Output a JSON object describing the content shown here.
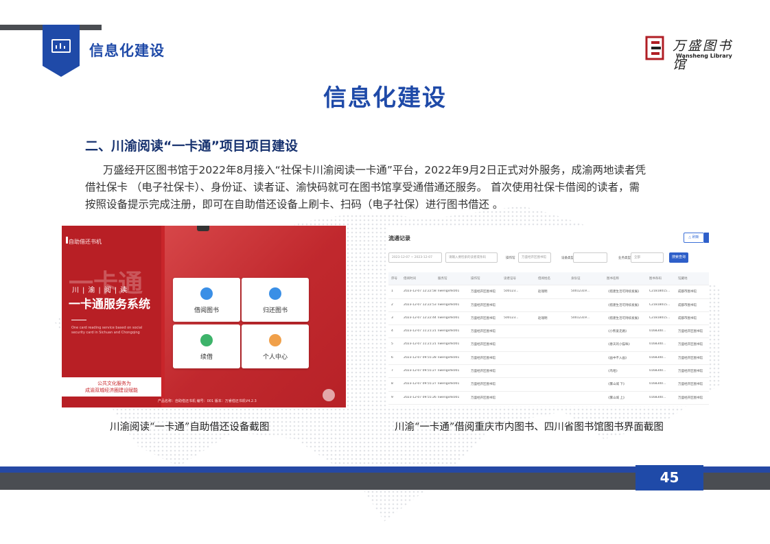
{
  "header": {
    "title": "信息化建设",
    "logo_cn": "万盛图书馆",
    "logo_en": "Wansheng Library"
  },
  "main_title": "信息化建设",
  "section_heading": "二、川渝阅读“一卡通”项目项目建设",
  "paragraph": {
    "line1": "万盛经开区图书馆于2022年8月接入“社保卡川渝阅读一卡通”平台，2022年9月2日正式对外服务，成渝两地读者凭",
    "line2": "借社保卡 （电子社保卡）、身份证、读者证、渝快码就可在图书馆享受通借通还服务。 首次使用社保卡借阅的读者，需",
    "line3": "按照设备提示完成注册，即可在自助借还设备上刷卡、扫码（电子社保）进行图书借还 。"
  },
  "left_screenshot": {
    "brand": "自助借还书机",
    "watermark": "一卡通",
    "subtitle": "川|渝|阅|读",
    "system_title": "一卡通服务系统",
    "english": "One card reading service based on social security card in Sichuan and Chongqing",
    "slogan1": "公共文化服务为",
    "slogan2": "成渝双城经济圈建设赋能",
    "footer": "产品名称：自助借还书机   编号：001   版本：万睿借还书机V4.2.3",
    "tiles": [
      {
        "label": "借阅图书"
      },
      {
        "label": "归还图书"
      },
      {
        "label": "续借"
      },
      {
        "label": "个人中心"
      }
    ]
  },
  "right_screenshot": {
    "title": "流通记录",
    "refresh_label": "△ 刷新",
    "date_range": "2023-12-07  ~  2023-12-07",
    "search_placeholder": "请输入要检索的读者或条码",
    "filter1_label": "操作馆",
    "filter1_value": "万盛经开区图书馆",
    "filter2_label": "设备类型",
    "filter3_label": "业务类型",
    "filter3_value": "全部",
    "search_button": "搜索查询",
    "columns": [
      "序号",
      "借阅时间",
      "服务馆",
      "操作馆",
      "读者证号",
      "借阅姓名",
      "身份证",
      "图书名称",
      "图书条码",
      "馆藏地"
    ],
    "rows": [
      [
        "1",
        "2023-12-07 12:22:58",
        "liwengxhk001",
        "万盛经开区图书馆",
        "500123...",
        "赵瑞明",
        "50012319...",
        "《搭建生活可持续发展》",
        "C21818015...",
        "成都市图书馆"
      ],
      [
        "2",
        "2023-12-07 12:22:53",
        "liwengxhk001",
        "万盛经开区图书馆",
        "",
        "",
        "",
        "《搭建生活可持续发展》",
        "C21818015...",
        "成都市图书馆"
      ],
      [
        "3",
        "2023-12-07 12:22:44",
        "liwengxhk001",
        "万盛经开区图书馆",
        "500123...",
        "赵瑞明",
        "50012319...",
        "《搭建生活可持续发展》",
        "C21818015...",
        "成都市图书馆"
      ],
      [
        "4",
        "2023-12-07 11:21:21",
        "liwengxhk001",
        "万盛经开区图书馆",
        "",
        "",
        "",
        "《小熊爱走路》",
        "0168300...",
        "万盛经开区图书馆"
      ],
      [
        "5",
        "2023-12-07 11:21:21",
        "liwengxhk001",
        "万盛经开区图书馆",
        "",
        "",
        "",
        "《春天的小猫咪》",
        "0168300...",
        "万盛经开区图书馆"
      ],
      [
        "6",
        "2023-12-07 09:55:28",
        "liwengxhk001",
        "万盛经开区图书馆",
        "",
        "",
        "",
        "《画中不入画》",
        "0168300...",
        "万盛经开区图书馆"
      ],
      [
        "7",
        "2023-12-07 09:55:27",
        "liwengxhk001",
        "万盛经开区图书馆",
        "",
        "",
        "",
        "《鸟哈》",
        "0168300...",
        "万盛经开区图书馆"
      ],
      [
        "8",
        "2023-12-07 09:55:27",
        "liwengxhk001",
        "万盛经开区图书馆",
        "",
        "",
        "",
        "《雾山城 下》",
        "0168300...",
        "万盛经开区图书馆"
      ],
      [
        "9",
        "2023-12-07 09:55:26",
        "liwengxhk001",
        "万盛经开区图书馆",
        "",
        "",
        "",
        "《雾山城 上》",
        "0168300...",
        "万盛经开区图书馆"
      ]
    ]
  },
  "captions": {
    "left": "川渝阅读“一卡通”自助借还设备截图",
    "right": "川渝“一卡通”借阅重庆市内图书、四川省图书馆图书界面截图"
  },
  "page_number": "45",
  "colors": {
    "brand_blue": "#1f4aa8",
    "dark_gray": "#4a4d52",
    "red": "#c8252a"
  }
}
